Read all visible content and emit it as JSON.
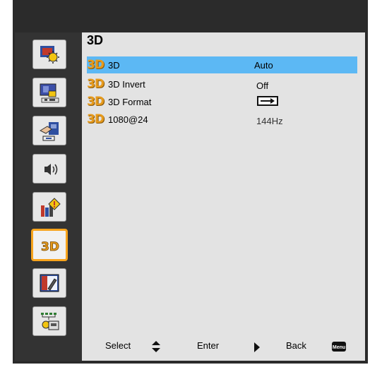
{
  "menu": {
    "title": "3D",
    "rows": [
      {
        "label": "3D",
        "value": "Auto"
      },
      {
        "label": "3D Invert",
        "value": "Off"
      },
      {
        "label": "3D Format",
        "value": ""
      },
      {
        "label": "1080@24",
        "value": "144Hz"
      }
    ],
    "row_tag": "3D",
    "selected_index": 0
  },
  "sidebar": {
    "items": [
      {
        "icon": "image-settings-icon"
      },
      {
        "icon": "display-settings-icon"
      },
      {
        "icon": "setup-icon"
      },
      {
        "icon": "audio-icon"
      },
      {
        "icon": "options-icon"
      },
      {
        "icon": "3d-icon",
        "label": "3D",
        "active": true
      },
      {
        "icon": "color-calibration-icon"
      },
      {
        "icon": "lan-icon"
      }
    ]
  },
  "footer": {
    "select_label": "Select",
    "enter_label": "Enter",
    "back_label": "Back",
    "menu_key_label": "Menu"
  },
  "colors": {
    "selection": "#5cb8f4",
    "accent": "#f7a41d",
    "background": "#2b2b2b",
    "panel": "#e3e3e3"
  }
}
